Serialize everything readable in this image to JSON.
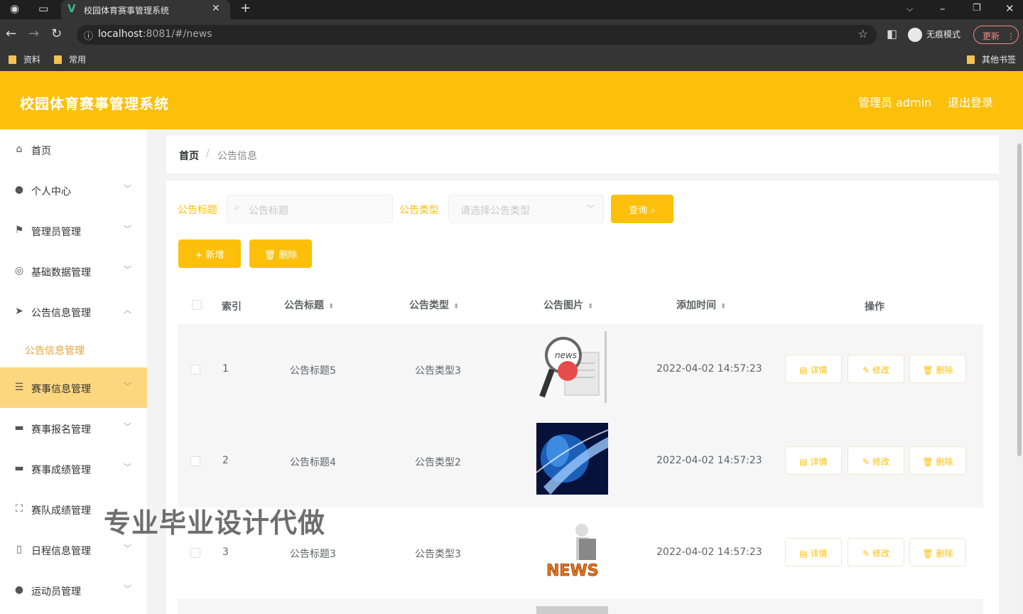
{
  "browser": {
    "tab_title": "校园体育赛事管理系统",
    "url_host": "localhost",
    "url_rest": ":8081/#/news",
    "incognito_label": "无痕模式",
    "update_label": "更新",
    "bookmarks": [
      "资料",
      "常用"
    ],
    "other_bookmarks": "其他书签"
  },
  "header": {
    "title": "校园体育赛事管理系统",
    "admin": "管理员 admin",
    "logout": "退出登录",
    "color": "#fcbf0a"
  },
  "sidebar": {
    "items": [
      {
        "label": "首页",
        "icon": "home-icon"
      },
      {
        "label": "个人中心",
        "icon": "user-icon"
      },
      {
        "label": "管理员管理",
        "icon": "flag-icon"
      },
      {
        "label": "基础数据管理",
        "icon": "circle-icon"
      },
      {
        "label": "公告信息管理",
        "icon": "send-icon"
      },
      {
        "label": "赛事信息管理",
        "icon": "sliders-icon"
      },
      {
        "label": "赛事报名管理",
        "icon": "monitor-icon"
      },
      {
        "label": "赛事成绩管理",
        "icon": "monitor-icon"
      },
      {
        "label": "赛队成绩管理",
        "icon": "fullscreen-icon"
      },
      {
        "label": "日程信息管理",
        "icon": "phone-icon"
      },
      {
        "label": "运动员管理",
        "icon": "pin-icon"
      }
    ],
    "submenu": {
      "label": "公告信息管理"
    }
  },
  "breadcrumb": {
    "home": "首页",
    "separator": "/",
    "current": "公告信息"
  },
  "filters": {
    "title_label": "公告标题",
    "title_placeholder": "公告标题",
    "type_label": "公告类型",
    "type_placeholder": "请选择公告类型",
    "search_button": "查询"
  },
  "actions": {
    "add": "新增",
    "delete": "删除"
  },
  "table": {
    "headers": [
      "索引",
      "公告标题",
      "公告类型",
      "公告图片",
      "添加时间",
      "操作"
    ],
    "rows": [
      {
        "index": "1",
        "title": "公告标题5",
        "type": "公告类型3",
        "time": "2022-04-02 14:57:23"
      },
      {
        "index": "2",
        "title": "公告标题4",
        "type": "公告类型2",
        "time": "2022-04-02 14:57:23"
      },
      {
        "index": "3",
        "title": "公告标题3",
        "type": "公告类型3",
        "time": "2022-04-02 14:57:23"
      }
    ],
    "row_buttons": {
      "detail": "详情",
      "edit": "修改",
      "delete": "删除"
    }
  },
  "watermark": "专业毕业设计代做"
}
